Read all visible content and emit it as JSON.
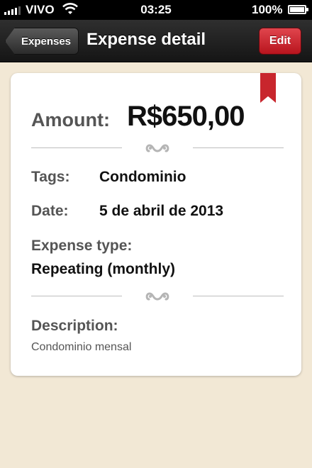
{
  "status_bar": {
    "carrier": "VIVO",
    "time": "03:25",
    "battery": "100%",
    "battery_level": 1.0,
    "signal_bars": 4
  },
  "nav": {
    "back_label": "Expenses",
    "title": "Expense detail",
    "edit_label": "Edit"
  },
  "detail": {
    "amount_label": "Amount:",
    "amount_value": "R$650,00",
    "tags_label": "Tags:",
    "tags_value": "Condominio",
    "date_label": "Date:",
    "date_value": "5 de abril de 2013",
    "type_label": "Expense type:",
    "type_value": "Repeating (monthly)",
    "description_label": "Description:",
    "description_value": "Condominio mensal"
  },
  "colors": {
    "background": "#f2e8d5",
    "edit_button": "#c8262d",
    "ribbon": "#c8262d",
    "label_text": "#555555",
    "value_text": "#111111"
  },
  "icons": {
    "divider": "flourish-ornament-icon",
    "bookmark": "bookmark-ribbon-icon"
  }
}
